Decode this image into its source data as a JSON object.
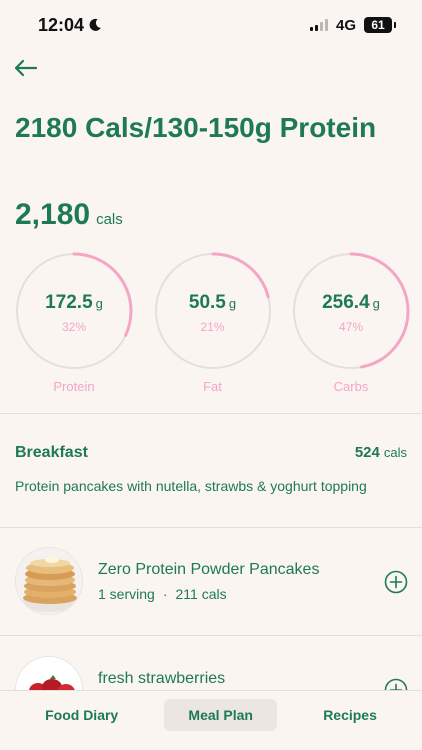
{
  "status_bar": {
    "time": "12:04",
    "network": "4G",
    "battery": "61"
  },
  "header": {
    "title": "2180 Cals/130-150g Protein",
    "total_value": "2,180",
    "total_unit": "cals"
  },
  "macros": [
    {
      "name": "Protein",
      "value": "172.5",
      "unit": "g",
      "percent_label": "32%",
      "percent": 32
    },
    {
      "name": "Fat",
      "value": "50.5",
      "unit": "g",
      "percent_label": "21%",
      "percent": 21
    },
    {
      "name": "Carbs",
      "value": "256.4",
      "unit": "g",
      "percent_label": "47%",
      "percent": 47
    }
  ],
  "meal": {
    "name": "Breakfast",
    "cals_value": "524",
    "cals_unit": "cals",
    "description": "Protein pancakes with nutella, strawbs & yoghurt topping"
  },
  "foods": [
    {
      "name": "Zero Protein Powder Pancakes",
      "serving": "1 serving",
      "dot": "·",
      "cals": "211 cals",
      "image": "pancakes"
    },
    {
      "name": "fresh strawberries",
      "serving": "",
      "dot": "",
      "cals": "",
      "image": "strawberries"
    }
  ],
  "nav": {
    "food_diary": "Food Diary",
    "meal_plan": "Meal Plan",
    "recipes": "Recipes"
  },
  "colors": {
    "brand_green": "#1d7a55",
    "ring_pink": "#f3a6c6",
    "ring_track": "#e6dedb",
    "background": "#fbf5f2"
  },
  "icons": [
    "back-arrow-icon",
    "moon-icon",
    "signal-icon",
    "battery-icon",
    "plus-circle-icon"
  ]
}
